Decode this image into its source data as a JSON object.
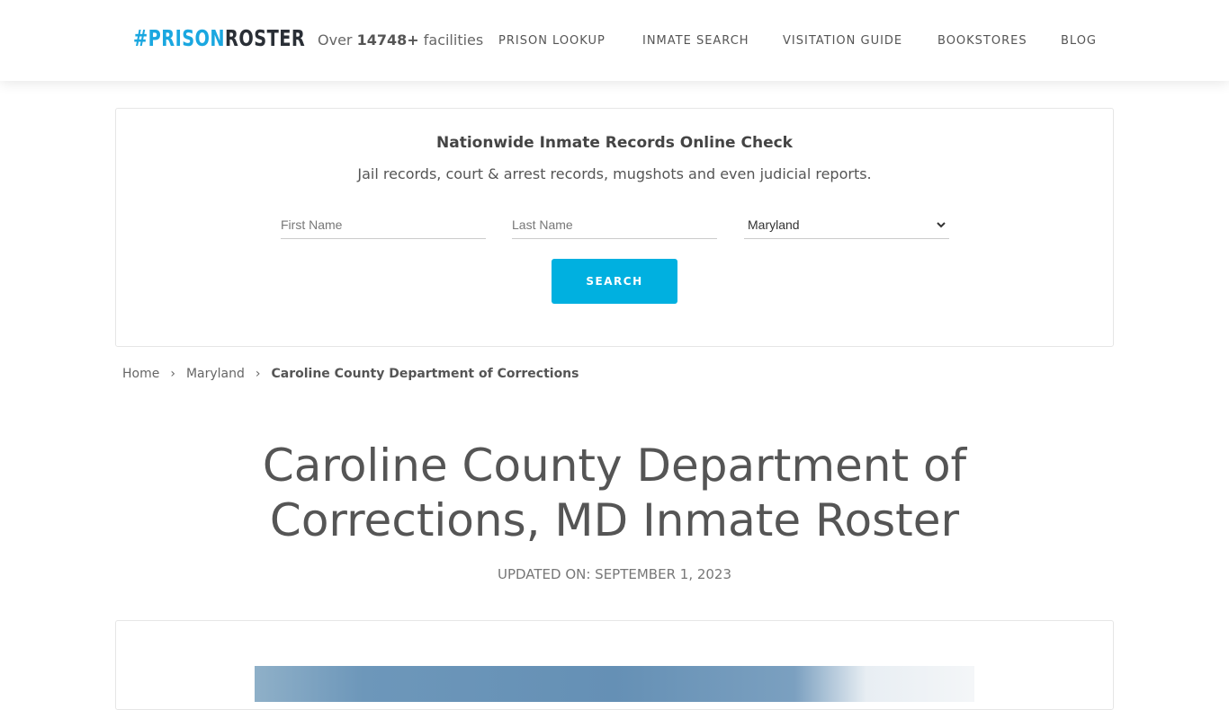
{
  "header": {
    "logo_hash": "#PRISON",
    "logo_rest": "ROSTER",
    "facilities_prefix": "Over",
    "facilities_count": "14748+",
    "facilities_suffix": "facilities",
    "nav": [
      "PRISON LOOKUP",
      "INMATE SEARCH",
      "VISITATION GUIDE",
      "BOOKSTORES",
      "BLOG"
    ]
  },
  "search": {
    "title": "Nationwide Inmate Records Online Check",
    "subtitle": "Jail records, court & arrest records, mugshots and even judicial reports.",
    "first_name_placeholder": "First Name",
    "last_name_placeholder": "Last Name",
    "state_selected": "Maryland",
    "button": "SEARCH"
  },
  "breadcrumb": [
    "Home",
    "Maryland",
    "Caroline County Department of Corrections"
  ],
  "page": {
    "title_line1": "Caroline County Department of",
    "title_line2": "Corrections, MD Inmate Roster",
    "updated": "UPDATED ON: SEPTEMBER 1, 2023"
  },
  "colors": {
    "accent": "#00b0e0",
    "logo_dark": "#2a2f36"
  }
}
